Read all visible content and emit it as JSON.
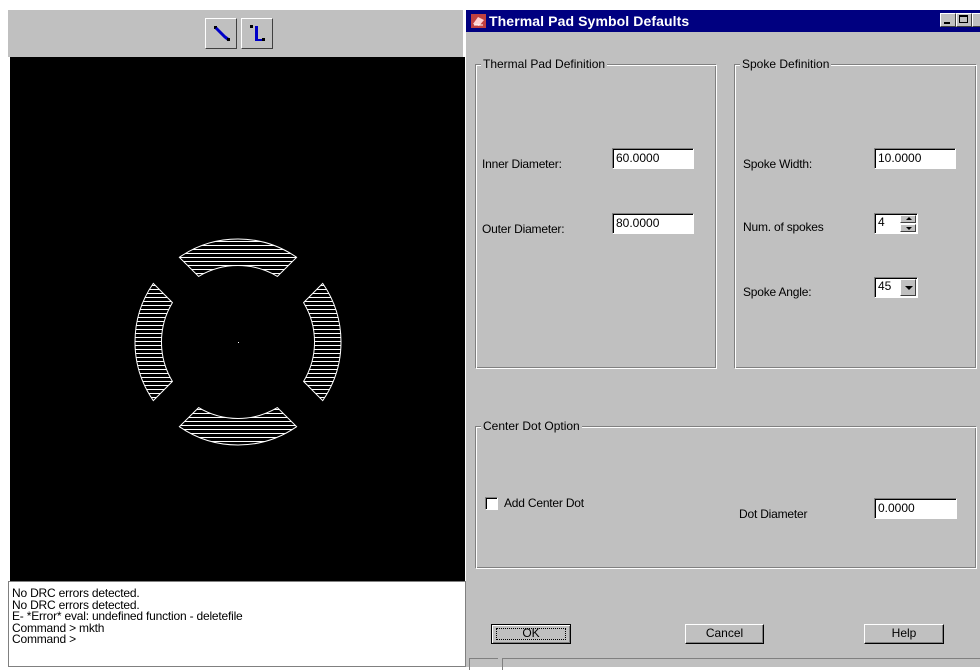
{
  "cad_toolbar": {
    "tools": [
      {
        "icon": "route-connect-icon"
      },
      {
        "icon": "via-icon"
      }
    ]
  },
  "canvas": {
    "drawing": "thermal-pad-preview",
    "background": "#000000",
    "stroke": "#ffffff"
  },
  "console": {
    "lines": [
      "No DRC errors detected.",
      "No DRC errors detected.",
      "E- *Error* eval: undefined function - deletefile",
      "Command > mkth",
      "Command >"
    ]
  },
  "dialog": {
    "title": "Thermal Pad Symbol Defaults",
    "titlebar_color": "#000080",
    "thermal_pad": {
      "legend": "Thermal Pad Definition",
      "inner_diameter_label": "Inner Diameter:",
      "inner_diameter_value": "60.0000",
      "outer_diameter_label": "Outer Diameter:",
      "outer_diameter_value": "80.0000"
    },
    "spoke": {
      "legend": "Spoke Definition",
      "spoke_width_label": "Spoke Width:",
      "spoke_width_value": "10.0000",
      "num_spokes_label": "Num. of spokes",
      "num_spokes_value": "4",
      "spoke_angle_label": "Spoke Angle:",
      "spoke_angle_value": "45"
    },
    "center_dot": {
      "legend": "Center Dot Option",
      "add_center_dot_label": "Add Center Dot",
      "add_center_dot_checked": false,
      "dot_diameter_label": "Dot Diameter",
      "dot_diameter_value": "0.0000"
    },
    "buttons": {
      "ok": "OK",
      "cancel": "Cancel",
      "help": "Help"
    }
  }
}
